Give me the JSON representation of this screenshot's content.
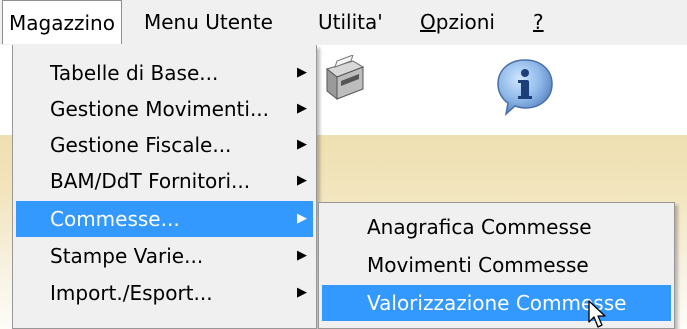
{
  "menubar": {
    "items": [
      {
        "label": "Magazzino"
      },
      {
        "label": "Menu Utente"
      },
      {
        "label": "Utilita'"
      },
      {
        "label_prefix": "",
        "mnemonic": "O",
        "label_rest": "pzioni"
      },
      {
        "label": "?"
      }
    ]
  },
  "main_menu": {
    "items": [
      {
        "label": "Tabelle di Base..."
      },
      {
        "label": "Gestione Movimenti..."
      },
      {
        "label": "Gestione Fiscale..."
      },
      {
        "label": "BAM/DdT Fornitori..."
      },
      {
        "label": "Commesse..."
      },
      {
        "label": "Stampe Varie..."
      },
      {
        "label": "Import./Esport..."
      }
    ],
    "highlighted_index": 4
  },
  "sub_menu": {
    "items": [
      {
        "label": "Anagrafica Commesse"
      },
      {
        "label": "Movimenti Commesse"
      },
      {
        "label": "Valorizzazione Commesse"
      }
    ],
    "highlighted_index": 2
  },
  "icons": {
    "submenu_arrow": "triangle-right-icon",
    "toolbar_1": "printer-icon",
    "toolbar_2": "info-icon",
    "cursor": "mouse-pointer-icon"
  },
  "colors": {
    "highlight": "#3399ff",
    "menu_bg": "#f0f0f0",
    "workspace": "#efe0b2"
  }
}
